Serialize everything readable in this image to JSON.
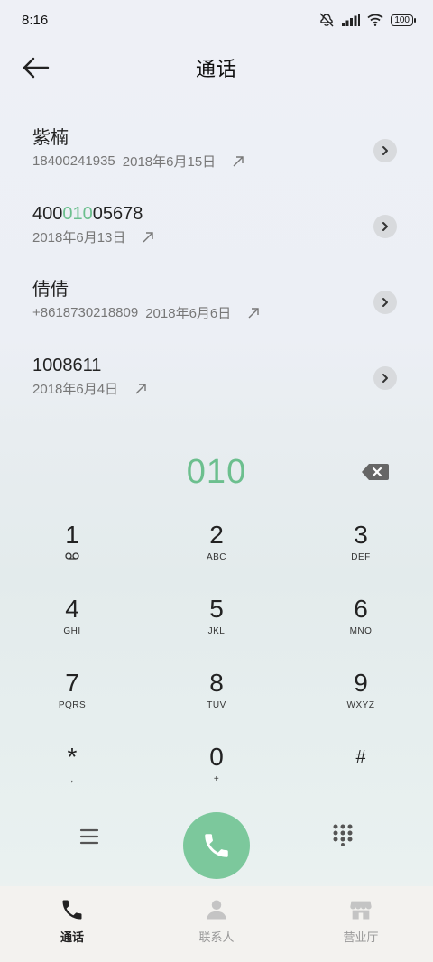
{
  "status": {
    "time": "8:16",
    "battery": "100"
  },
  "header": {
    "title": "通话"
  },
  "calls": [
    {
      "name": "紫楠",
      "name_prefix": "",
      "name_highlight": "",
      "name_suffix": "",
      "number": "18400241935",
      "date": "2018年6月15日"
    },
    {
      "name": "",
      "name_prefix": "400",
      "name_highlight": "010",
      "name_suffix": "05678",
      "number": "",
      "date": "2018年6月13日"
    },
    {
      "name": "倩倩",
      "name_prefix": "",
      "name_highlight": "",
      "name_suffix": "",
      "number": "+8618730218809",
      "date": "2018年6月6日"
    },
    {
      "name": "1008611",
      "name_prefix": "",
      "name_highlight": "",
      "name_suffix": "",
      "number": "",
      "date": "2018年6月4日"
    }
  ],
  "dialer": {
    "input": "010"
  },
  "keys": [
    {
      "digit": "1",
      "sub": ""
    },
    {
      "digit": "2",
      "sub": "ABC"
    },
    {
      "digit": "3",
      "sub": "DEF"
    },
    {
      "digit": "4",
      "sub": "GHI"
    },
    {
      "digit": "5",
      "sub": "JKL"
    },
    {
      "digit": "6",
      "sub": "MNO"
    },
    {
      "digit": "7",
      "sub": "PQRS"
    },
    {
      "digit": "8",
      "sub": "TUV"
    },
    {
      "digit": "9",
      "sub": "WXYZ"
    },
    {
      "digit": "*",
      "sub": ","
    },
    {
      "digit": "0",
      "sub": "+"
    },
    {
      "digit": "#",
      "sub": ""
    }
  ],
  "tabs": [
    {
      "label": "通话",
      "icon": "phone-icon"
    },
    {
      "label": "联系人",
      "icon": "contact-icon"
    },
    {
      "label": "营业厅",
      "icon": "store-icon"
    }
  ],
  "colors": {
    "accent": "#6cbf8e",
    "call_button": "#7cc89c"
  }
}
